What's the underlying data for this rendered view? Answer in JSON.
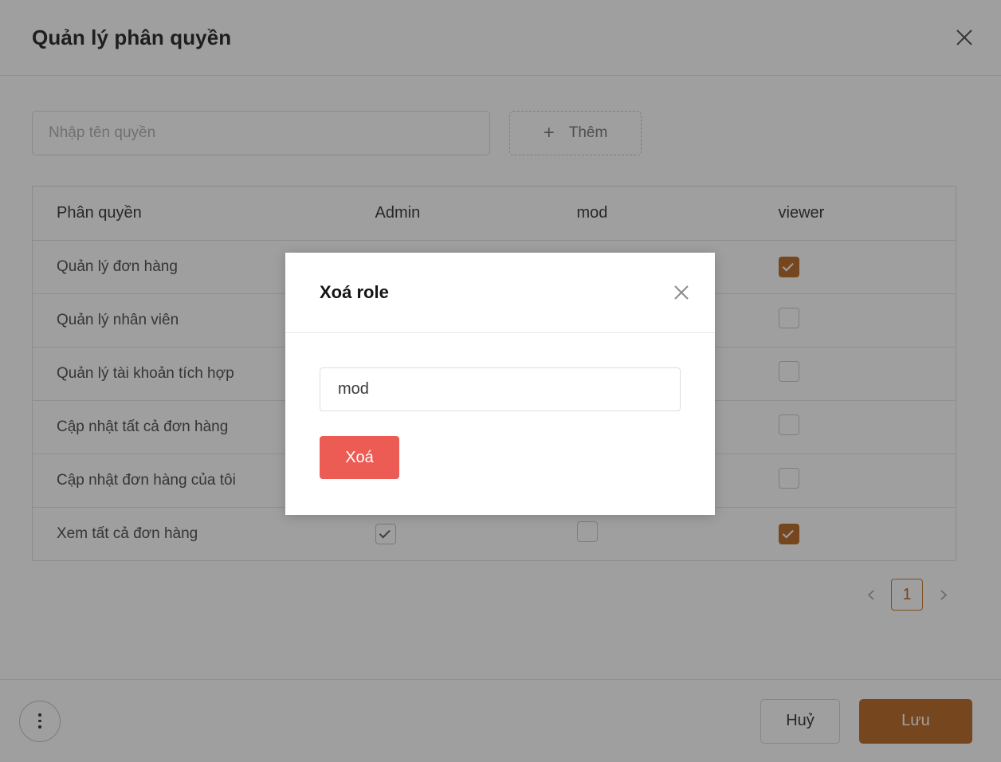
{
  "header": {
    "title": "Quản lý phân quyền",
    "close_icon": "close-icon"
  },
  "add_row": {
    "input_placeholder": "Nhập tên quyền",
    "input_value": "",
    "add_label": "Thêm",
    "plus_icon": "plus-icon"
  },
  "table": {
    "columns": [
      "Phân quyền",
      "Admin",
      "mod",
      "viewer"
    ],
    "rows": [
      {
        "name": "Quản lý đơn hàng",
        "admin": "hidden",
        "mod": "hidden",
        "viewer": "checked"
      },
      {
        "name": "Quản lý nhân viên",
        "admin": "hidden",
        "mod": "hidden",
        "viewer": "unchecked"
      },
      {
        "name": "Quản lý tài khoản tích hợp",
        "admin": "hidden",
        "mod": "hidden",
        "viewer": "unchecked"
      },
      {
        "name": "Cập nhật tất cả đơn hàng",
        "admin": "hidden",
        "mod": "hidden",
        "viewer": "unchecked"
      },
      {
        "name": "Cập nhật đơn hàng của tôi",
        "admin": "hidden",
        "mod": "hidden",
        "viewer": "unchecked"
      },
      {
        "name": "Xem tất cả đơn hàng",
        "admin": "disabled-checked",
        "mod": "unchecked",
        "viewer": "checked"
      }
    ]
  },
  "pagination": {
    "prev_icon": "chevron-left-icon",
    "next_icon": "chevron-right-icon",
    "current_page": "1"
  },
  "footer": {
    "more_icon": "more-vertical-icon",
    "cancel_label": "Huỷ",
    "save_label": "Lưu"
  },
  "delete_modal": {
    "title": "Xoá role",
    "close_icon": "close-icon",
    "input_value": "mod",
    "confirm_label": "Xoá"
  },
  "colors": {
    "accent": "#b35d12",
    "danger": "#ec5b54",
    "overlay": "rgba(46,46,46,0.46)"
  }
}
